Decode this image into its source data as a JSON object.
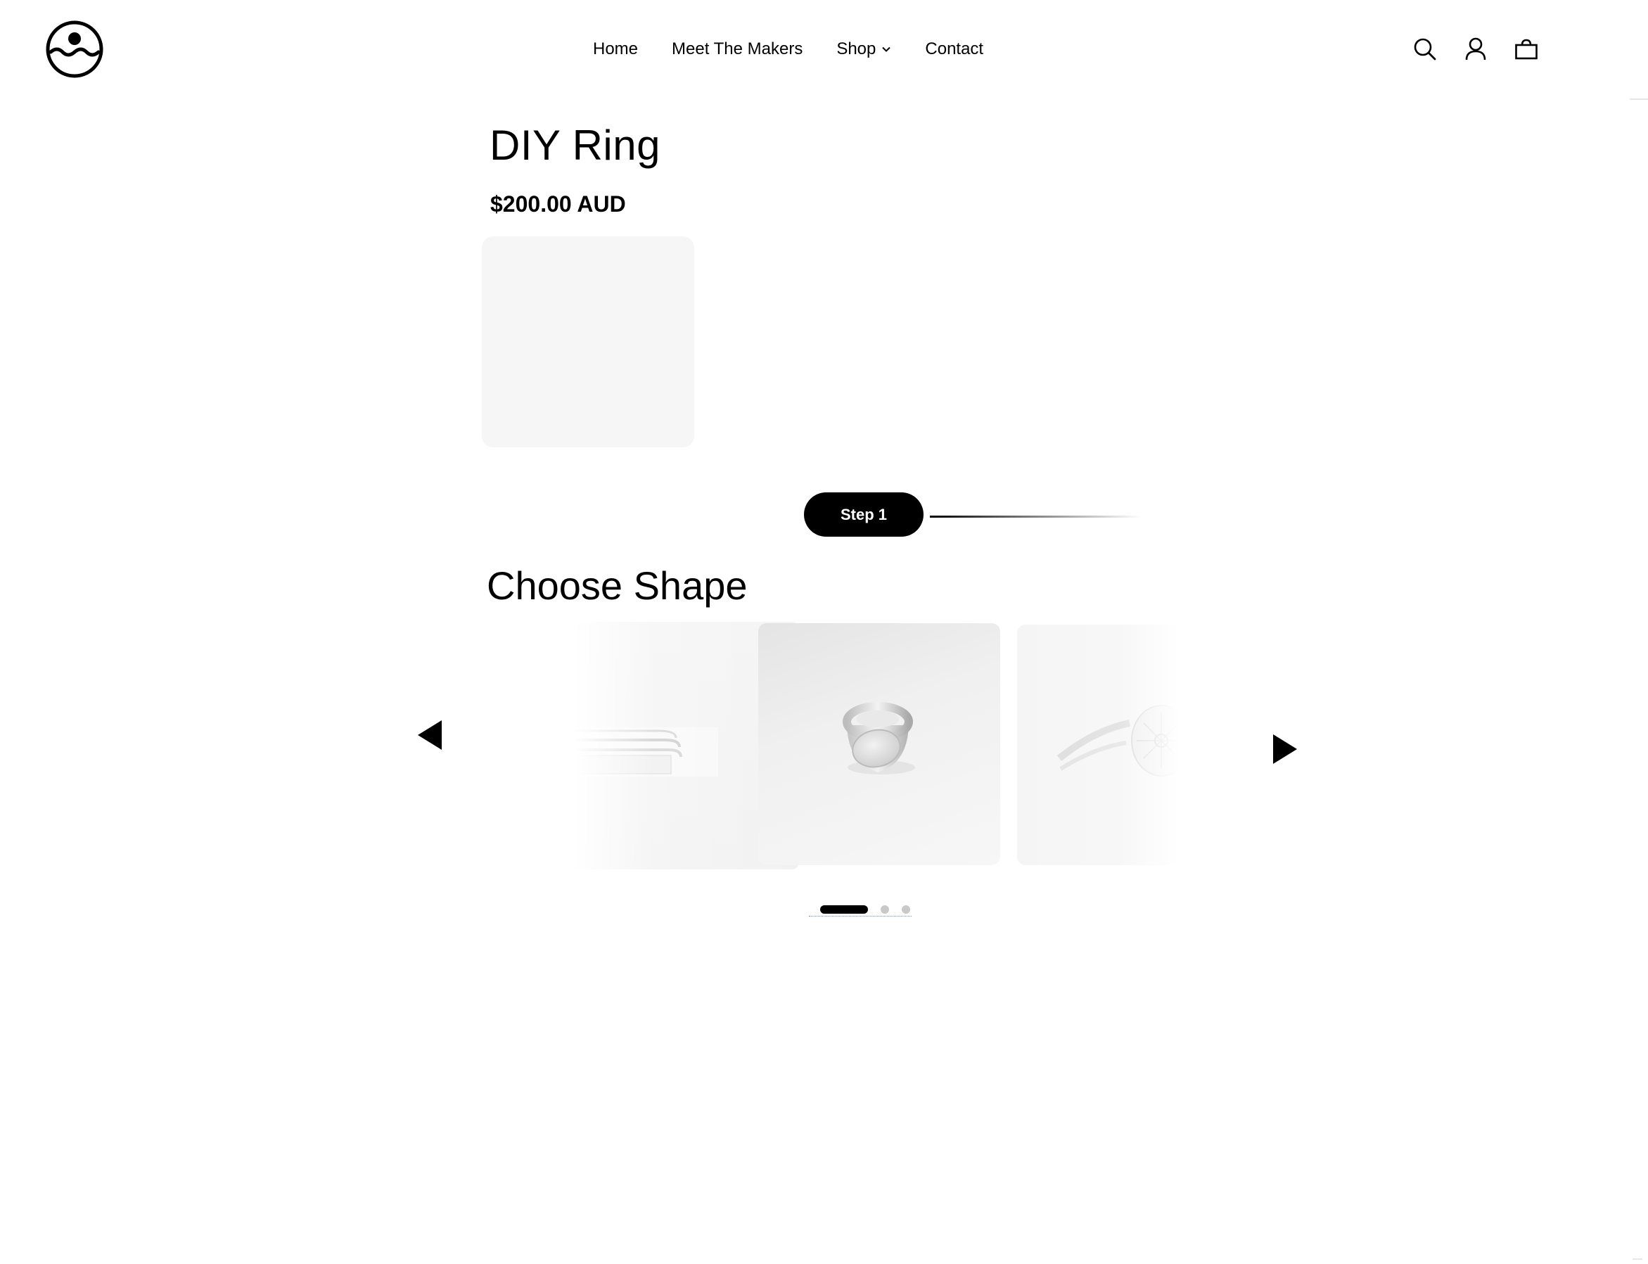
{
  "header": {
    "logo_icon": "wave-face-logo-icon",
    "nav": [
      {
        "label": "Home"
      },
      {
        "label": "Meet The Makers"
      },
      {
        "label": "Shop",
        "has_dropdown": true
      },
      {
        "label": "Contact"
      }
    ],
    "icons": [
      "search-icon",
      "account-icon",
      "cart-icon"
    ]
  },
  "product": {
    "title": "DIY Ring",
    "price": "$200.00 AUD"
  },
  "step": {
    "label": "Step 1"
  },
  "section": {
    "title": "Choose Shape"
  },
  "carousel": {
    "prev_icon": "triangle-left-icon",
    "next_icon": "triangle-right-icon",
    "slides": [
      {
        "name": "stacked-band-ring"
      },
      {
        "name": "round-signet-ring"
      },
      {
        "name": "engraved-sun-signet-ring"
      }
    ],
    "dots_total": 3,
    "active_dot": 1
  },
  "colors": {
    "accent": "#000000",
    "preview_bg": "#f6f6f6",
    "dot_inactive": "#c8c8c8"
  }
}
